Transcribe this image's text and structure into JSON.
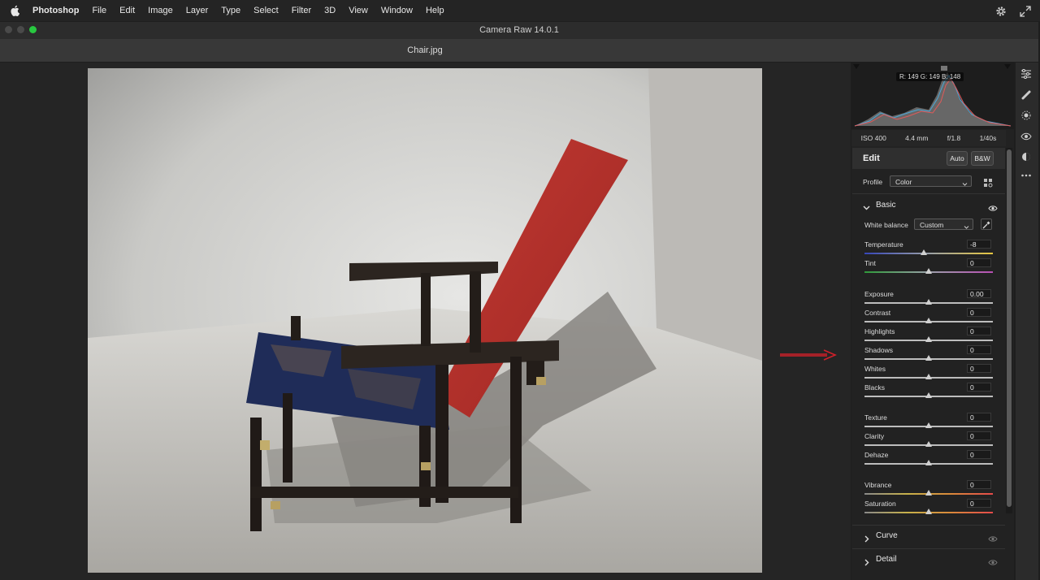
{
  "menubar": {
    "app": "Photoshop",
    "items": [
      "File",
      "Edit",
      "Image",
      "Layer",
      "Type",
      "Select",
      "Filter",
      "3D",
      "View",
      "Window",
      "Help"
    ]
  },
  "window": {
    "title": "Camera Raw 14.0.1"
  },
  "document": {
    "title": "Chair.jpg"
  },
  "histogram": {
    "rgb_readout": "R: 149  G: 149  B: 148"
  },
  "camera_info": {
    "iso": "ISO 400",
    "focal": "4.4 mm",
    "aperture": "f/1.8",
    "shutter": "1/40s"
  },
  "edit": {
    "title": "Edit",
    "auto_label": "Auto",
    "bw_label": "B&W"
  },
  "profile": {
    "label": "Profile",
    "value": "Color"
  },
  "basic": {
    "title": "Basic",
    "white_balance_label": "White balance",
    "white_balance_value": "Custom",
    "sliders": [
      {
        "label": "Temperature",
        "value": "-8",
        "pos": 0.46,
        "track": "temp"
      },
      {
        "label": "Tint",
        "value": "0",
        "pos": 0.5,
        "track": "tint"
      },
      {
        "label": "Exposure",
        "value": "0.00",
        "pos": 0.5,
        "track": "plain"
      },
      {
        "label": "Contrast",
        "value": "0",
        "pos": 0.5,
        "track": "plain"
      },
      {
        "label": "Highlights",
        "value": "0",
        "pos": 0.5,
        "track": "plain"
      },
      {
        "label": "Shadows",
        "value": "0",
        "pos": 0.5,
        "track": "plain"
      },
      {
        "label": "Whites",
        "value": "0",
        "pos": 0.5,
        "track": "plain"
      },
      {
        "label": "Blacks",
        "value": "0",
        "pos": 0.5,
        "track": "plain"
      },
      {
        "label": "Texture",
        "value": "0",
        "pos": 0.5,
        "track": "plain"
      },
      {
        "label": "Clarity",
        "value": "0",
        "pos": 0.5,
        "track": "plain"
      },
      {
        "label": "Dehaze",
        "value": "0",
        "pos": 0.5,
        "track": "plain"
      },
      {
        "label": "Vibrance",
        "value": "0",
        "pos": 0.5,
        "track": "vib"
      },
      {
        "label": "Saturation",
        "value": "0",
        "pos": 0.5,
        "track": "vib"
      }
    ]
  },
  "curve": {
    "title": "Curve"
  },
  "detail": {
    "title": "Detail"
  },
  "colors": {
    "accent_arrow": "#d0202a",
    "chair_red": "#b8302c",
    "seat_blue": "#1e2d5c"
  }
}
